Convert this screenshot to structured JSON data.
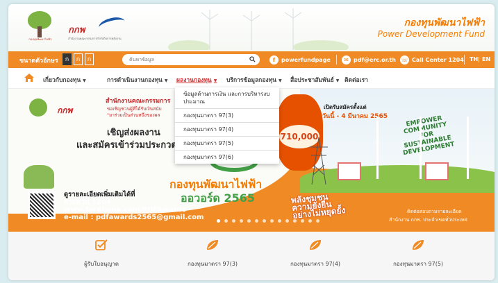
{
  "header": {
    "brand_th": "กองทุนพัฒนาไฟฟ้า",
    "brand_en": "Power Development Fund",
    "logo_tree_caption": "กองทุนพัฒนาไฟฟ้า",
    "logo_pdf_mark": "กกพ",
    "logo_pdf_sub": "สำนักงานคณะกรรมการกำกับกิจการพลังงาน"
  },
  "toolbar": {
    "font_size_label": "ขนาดตัวอักษร",
    "font_sizes": [
      "ก",
      "ก",
      "ก"
    ],
    "search_placeholder": "ค้นหาข้อมูล",
    "facebook": "powerfundpage",
    "email": "pdf@erc.or.th",
    "call_center": "Call Center 1204",
    "lang_th": "TH",
    "lang_sep": "|",
    "lang_en": "EN"
  },
  "nav": {
    "items": [
      "เกี่ยวกับกองทุน",
      "การดำเนินงานกองทุน",
      "ผลงานกองทุน",
      "บริการข้อมูลกองทุน",
      "สื่อประชาสัมพันธ์",
      "ติดต่อเรา"
    ],
    "active_index": 2
  },
  "dropdown": {
    "items": [
      "ข้อมูลด้านการเงิน และการบริหารงบประมาณ",
      "กองทุนมาตรา 97(3)",
      "กองทุนมาตรา 97(4)",
      "กองทุนมาตรา 97(5)",
      "กองทุนมาตรา 97(6)"
    ]
  },
  "banner": {
    "office": "สำนักงานคณะกรรมการ",
    "small1": "ขอเชิญชวนผู้ที่ได้รับเงินสนับ",
    "small2": "\"มาร่วมเป็นส่วนหนึ่งของผล",
    "invite1": "เชิญส่งผลงาน",
    "invite2": "และสมัครเข้าร่วมประกวด",
    "award1": "กองทุนพัฒนาไฟฟ้า",
    "award2": "ออวอร์ด 2565",
    "more_info": "ดูรายละเอียดเพิ่มเติมได้ที่",
    "phone": "สายด่วน 1204",
    "facebook": "www.facebook.com/PDFAwards",
    "email": "e-mail : pdfawards2565@gmail.com",
    "open": "เปิดรับสมัครตั้งแต่",
    "date": "วันนี้ - 4 มีนาคม 2565",
    "prize": "710,000",
    "empower": "EMPOWER COMMUNITY FOR SUSTAINABLE DEVELOPMENT",
    "sustain_line1": "พลังชุมชน",
    "sustain_line2": "ความยั่งยืน",
    "sustain_line3": "อย่างไม่หยุดยั้ง",
    "foot1": "ติดต่อสอบถามรายละเอียด",
    "foot2": "สำนักงาน กกพ. ประจำเขตทั่วประเทศ"
  },
  "quick_links": [
    {
      "label": "ผู้รับใบอนุญาต",
      "icon": "checkbox-icon"
    },
    {
      "label": "กองทุนมาตรา 97(3)",
      "icon": "leaf-icon"
    },
    {
      "label": "กองทุนมาตรา 97(4)",
      "icon": "leaf-icon"
    },
    {
      "label": "กองทุนมาตรา 97(5)",
      "icon": "leaf-icon"
    }
  ],
  "colors": {
    "accent_orange": "#f08a24",
    "brand_orange": "#f57c00",
    "nav_active": "#d32f2f",
    "green": "#43a047"
  }
}
